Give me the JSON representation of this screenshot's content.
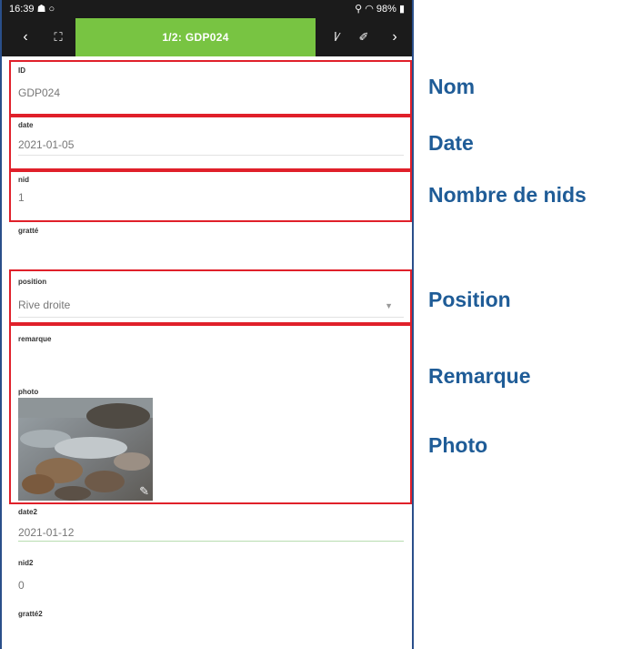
{
  "status_bar": {
    "time": "16:39",
    "left_icons": "☗ ○",
    "right_icons": "⚲ ◠ 98%",
    "battery_icon": "battery-icon"
  },
  "toolbar": {
    "back": "‹",
    "expand": "⛶",
    "title": "1/2: GDP024",
    "tool1": "ⅼ⁄",
    "tool2": "✐",
    "next": "›"
  },
  "form": {
    "id": {
      "label": "ID",
      "value": "GDP024"
    },
    "date": {
      "label": "date",
      "value": "2021-01-05"
    },
    "nid": {
      "label": "nid",
      "value": "1"
    },
    "gratte": {
      "label": "gratté",
      "value": ""
    },
    "position": {
      "label": "position",
      "value": "Rive droite"
    },
    "remarque": {
      "label": "remarque",
      "value": ""
    },
    "photo": {
      "label": "photo"
    },
    "date2": {
      "label": "date2",
      "value": "2021-01-12"
    },
    "nid2": {
      "label": "nid2",
      "value": "0"
    },
    "gratte2": {
      "label": "gratté2",
      "value": ""
    }
  },
  "annotations": {
    "nom": "Nom",
    "date": "Date",
    "nids": "Nombre de nids",
    "position": "Position",
    "remarque": "Remarque",
    "photo": "Photo"
  },
  "colors": {
    "accent_green": "#78c442",
    "highlight_red": "#e0202a",
    "annotation_blue": "#1f5c97",
    "toolbar_dark": "#1b1b1b"
  }
}
